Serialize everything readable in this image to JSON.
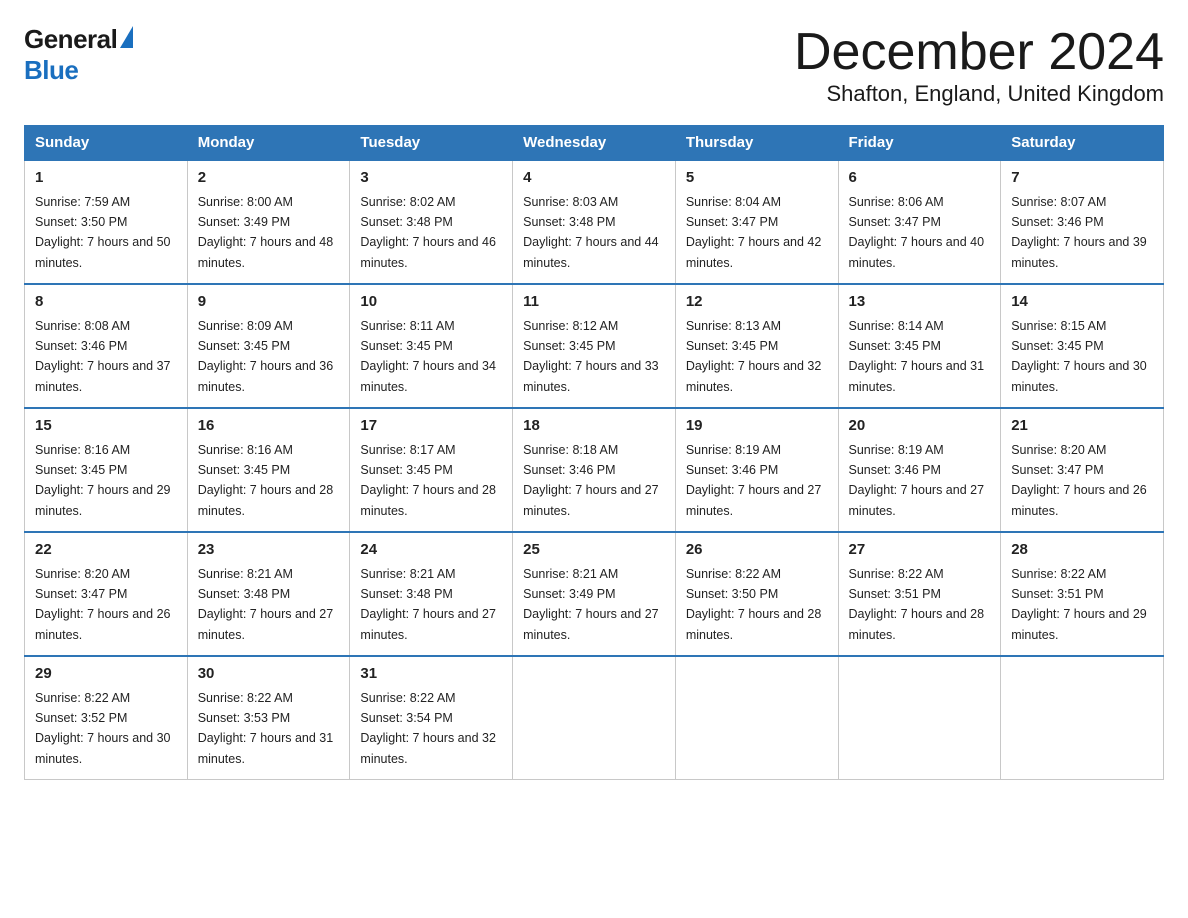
{
  "header": {
    "logo_general": "General",
    "logo_blue": "Blue",
    "month_title": "December 2024",
    "location": "Shafton, England, United Kingdom"
  },
  "days_of_week": [
    "Sunday",
    "Monday",
    "Tuesday",
    "Wednesday",
    "Thursday",
    "Friday",
    "Saturday"
  ],
  "weeks": [
    [
      {
        "day": "1",
        "sunrise": "7:59 AM",
        "sunset": "3:50 PM",
        "daylight": "7 hours and 50 minutes."
      },
      {
        "day": "2",
        "sunrise": "8:00 AM",
        "sunset": "3:49 PM",
        "daylight": "7 hours and 48 minutes."
      },
      {
        "day": "3",
        "sunrise": "8:02 AM",
        "sunset": "3:48 PM",
        "daylight": "7 hours and 46 minutes."
      },
      {
        "day": "4",
        "sunrise": "8:03 AM",
        "sunset": "3:48 PM",
        "daylight": "7 hours and 44 minutes."
      },
      {
        "day": "5",
        "sunrise": "8:04 AM",
        "sunset": "3:47 PM",
        "daylight": "7 hours and 42 minutes."
      },
      {
        "day": "6",
        "sunrise": "8:06 AM",
        "sunset": "3:47 PM",
        "daylight": "7 hours and 40 minutes."
      },
      {
        "day": "7",
        "sunrise": "8:07 AM",
        "sunset": "3:46 PM",
        "daylight": "7 hours and 39 minutes."
      }
    ],
    [
      {
        "day": "8",
        "sunrise": "8:08 AM",
        "sunset": "3:46 PM",
        "daylight": "7 hours and 37 minutes."
      },
      {
        "day": "9",
        "sunrise": "8:09 AM",
        "sunset": "3:45 PM",
        "daylight": "7 hours and 36 minutes."
      },
      {
        "day": "10",
        "sunrise": "8:11 AM",
        "sunset": "3:45 PM",
        "daylight": "7 hours and 34 minutes."
      },
      {
        "day": "11",
        "sunrise": "8:12 AM",
        "sunset": "3:45 PM",
        "daylight": "7 hours and 33 minutes."
      },
      {
        "day": "12",
        "sunrise": "8:13 AM",
        "sunset": "3:45 PM",
        "daylight": "7 hours and 32 minutes."
      },
      {
        "day": "13",
        "sunrise": "8:14 AM",
        "sunset": "3:45 PM",
        "daylight": "7 hours and 31 minutes."
      },
      {
        "day": "14",
        "sunrise": "8:15 AM",
        "sunset": "3:45 PM",
        "daylight": "7 hours and 30 minutes."
      }
    ],
    [
      {
        "day": "15",
        "sunrise": "8:16 AM",
        "sunset": "3:45 PM",
        "daylight": "7 hours and 29 minutes."
      },
      {
        "day": "16",
        "sunrise": "8:16 AM",
        "sunset": "3:45 PM",
        "daylight": "7 hours and 28 minutes."
      },
      {
        "day": "17",
        "sunrise": "8:17 AM",
        "sunset": "3:45 PM",
        "daylight": "7 hours and 28 minutes."
      },
      {
        "day": "18",
        "sunrise": "8:18 AM",
        "sunset": "3:46 PM",
        "daylight": "7 hours and 27 minutes."
      },
      {
        "day": "19",
        "sunrise": "8:19 AM",
        "sunset": "3:46 PM",
        "daylight": "7 hours and 27 minutes."
      },
      {
        "day": "20",
        "sunrise": "8:19 AM",
        "sunset": "3:46 PM",
        "daylight": "7 hours and 27 minutes."
      },
      {
        "day": "21",
        "sunrise": "8:20 AM",
        "sunset": "3:47 PM",
        "daylight": "7 hours and 26 minutes."
      }
    ],
    [
      {
        "day": "22",
        "sunrise": "8:20 AM",
        "sunset": "3:47 PM",
        "daylight": "7 hours and 26 minutes."
      },
      {
        "day": "23",
        "sunrise": "8:21 AM",
        "sunset": "3:48 PM",
        "daylight": "7 hours and 27 minutes."
      },
      {
        "day": "24",
        "sunrise": "8:21 AM",
        "sunset": "3:48 PM",
        "daylight": "7 hours and 27 minutes."
      },
      {
        "day": "25",
        "sunrise": "8:21 AM",
        "sunset": "3:49 PM",
        "daylight": "7 hours and 27 minutes."
      },
      {
        "day": "26",
        "sunrise": "8:22 AM",
        "sunset": "3:50 PM",
        "daylight": "7 hours and 28 minutes."
      },
      {
        "day": "27",
        "sunrise": "8:22 AM",
        "sunset": "3:51 PM",
        "daylight": "7 hours and 28 minutes."
      },
      {
        "day": "28",
        "sunrise": "8:22 AM",
        "sunset": "3:51 PM",
        "daylight": "7 hours and 29 minutes."
      }
    ],
    [
      {
        "day": "29",
        "sunrise": "8:22 AM",
        "sunset": "3:52 PM",
        "daylight": "7 hours and 30 minutes."
      },
      {
        "day": "30",
        "sunrise": "8:22 AM",
        "sunset": "3:53 PM",
        "daylight": "7 hours and 31 minutes."
      },
      {
        "day": "31",
        "sunrise": "8:22 AM",
        "sunset": "3:54 PM",
        "daylight": "7 hours and 32 minutes."
      },
      null,
      null,
      null,
      null
    ]
  ]
}
